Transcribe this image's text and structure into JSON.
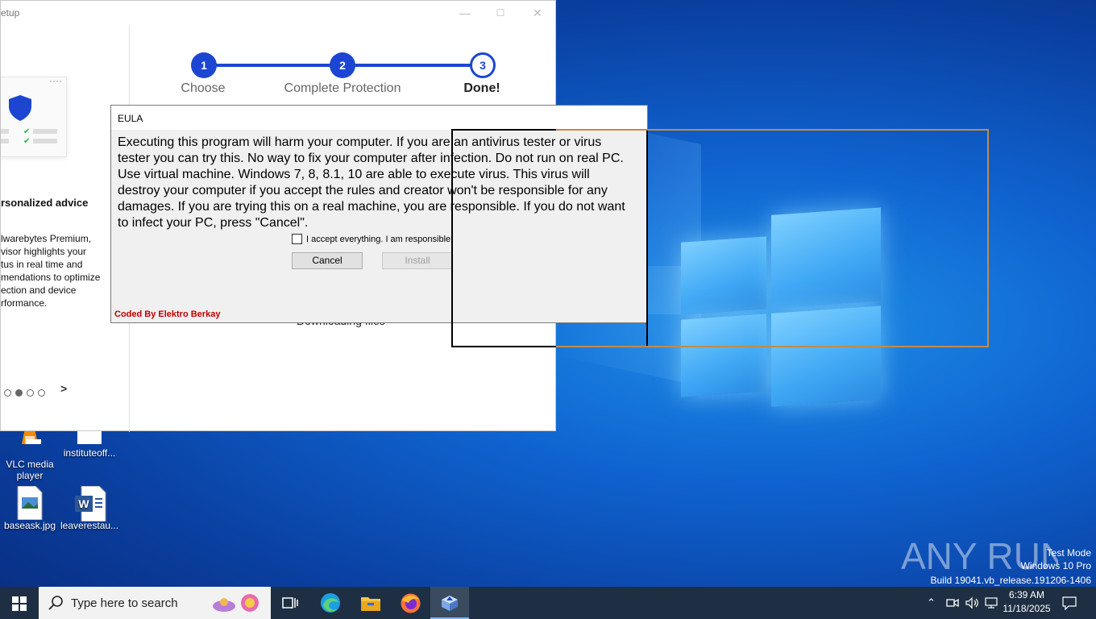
{
  "setup_window": {
    "title": "etup",
    "steps": [
      {
        "number": "1",
        "label": "Choose"
      },
      {
        "number": "2",
        "label": "Complete Protection"
      },
      {
        "number": "3",
        "label": "Done!"
      }
    ],
    "left_heading": "rsonalized advice",
    "left_body": [
      "lwarebytes Premium,",
      "visor highlights your",
      "tus in real time and",
      "mendations to optimize",
      "ection and device",
      "rformance."
    ],
    "status_text": "Downloading files",
    "next_glyph": ">"
  },
  "eula": {
    "title": "EULA",
    "message": "Executing this program will harm your computer. If you are an antivirus tester or virus tester you can try this. No way to fix your computer after infection. Do not run on real PC. Use virtual machine. Windows 7, 8, 8.1, 10 are able to execute virus. This virus will destroy your computer if you accept the rules and creator won't be responsible for any damages. If you are trying this on a real machine, you are responsible. If you do not want to infect your PC, press \"Cancel\".",
    "checkbox_label": "I accept everything. I am responsible",
    "cancel_label": "Cancel",
    "install_label": "Install",
    "credit": "Coded By Elektro Berkay"
  },
  "desktop_icons": [
    {
      "label": "VLC media player"
    },
    {
      "label": "instituteoff..."
    },
    {
      "label": "baseask.jpg"
    },
    {
      "label": "leaverestau..."
    }
  ],
  "watermark": {
    "brand": "ANY RUN",
    "lines": [
      "Test Mode",
      "Windows 10 Pro",
      "Build 19041.vb_release.191206-1406"
    ]
  },
  "taskbar": {
    "search_placeholder": "Type here to search",
    "time": "6:39 AM",
    "date": "11/18/2025"
  },
  "colors": {
    "accent_blue": "#1c46d1",
    "taskbar": "#1f2f43",
    "credit_red": "#c00000"
  }
}
